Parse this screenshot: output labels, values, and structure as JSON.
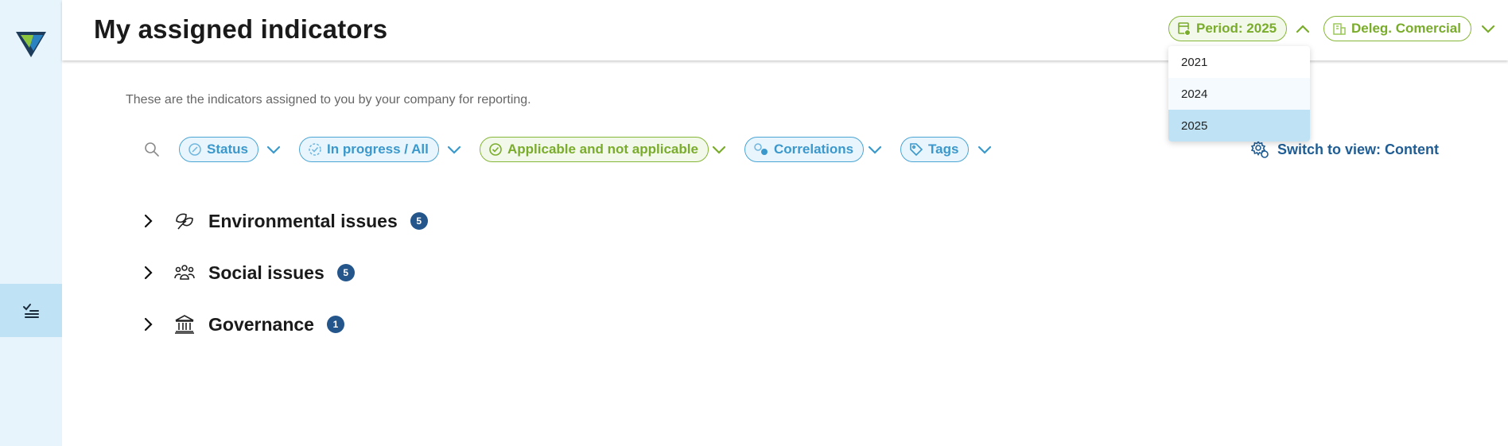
{
  "header": {
    "title": "My assigned indicators",
    "period_label": "Period: 2025",
    "delegation_label": "Deleg. Comercial"
  },
  "period_dropdown": {
    "options": [
      "2021",
      "2024",
      "2025"
    ],
    "selected": "2025"
  },
  "subtitle": "These are the indicators assigned to you by your company for reporting.",
  "filters": {
    "status": "Status",
    "progress": "In progress / All",
    "applicability": "Applicable and not applicable",
    "correlations": "Correlations",
    "tags": "Tags"
  },
  "switch_view_label": "Switch to view: Content",
  "groups": [
    {
      "label": "Environmental issues",
      "count": "5",
      "icon": "leaf-icon"
    },
    {
      "label": "Social issues",
      "count": "5",
      "icon": "people-icon"
    },
    {
      "label": "Governance",
      "count": "1",
      "icon": "institution-icon"
    }
  ],
  "colors": {
    "accent_green": "#7aac2c",
    "accent_blue": "#3a98cc",
    "badge_navy": "#24568c",
    "sidebar_bg": "#e8f4fb",
    "sidebar_active": "#bfe3f5"
  }
}
